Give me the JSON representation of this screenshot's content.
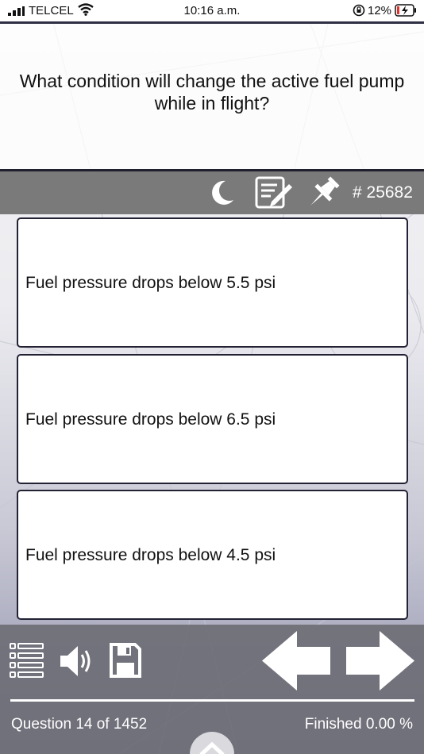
{
  "status_bar": {
    "carrier": "TELCEL",
    "time": "10:16 a.m.",
    "battery_percent": "12%"
  },
  "question": {
    "text": "What condition will change the active fuel pump while in flight?"
  },
  "toolbar": {
    "question_id": "# 25682",
    "icons": [
      "moon-icon",
      "notes-icon",
      "pin-icon"
    ]
  },
  "answers": [
    {
      "label": "Fuel pressure drops below 5.5 psi"
    },
    {
      "label": "Fuel pressure drops below 6.5 psi"
    },
    {
      "label": "Fuel pressure drops below 4.5 psi"
    }
  ],
  "bottom_bar": {
    "progress_label": "Question 14 of 1452",
    "finished_label": "Finished 0.00 %",
    "icons": [
      "list-icon",
      "speaker-icon",
      "save-icon",
      "arrow-left-icon",
      "arrow-right-icon",
      "chevron-up-icon"
    ]
  },
  "colors": {
    "toolbar": "#7a7a7a",
    "bottom_bar": "#6e6e76",
    "border": "#222234"
  }
}
